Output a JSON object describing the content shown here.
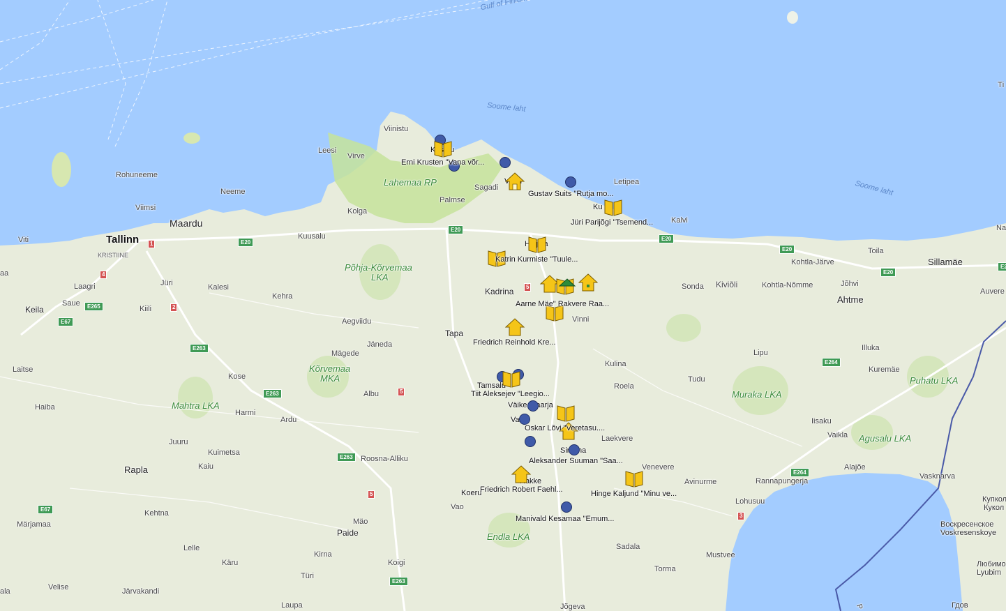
{
  "colors": {
    "sea": "#a3ccff",
    "land": "#e8ecdc",
    "park": "#c5e39b",
    "forest": "#d3e6b8",
    "marker": "#f5c518",
    "dot": "#3f5aa8",
    "border": "#4a5aa8"
  },
  "sea_labels": {
    "gulf": "Gulf of Finland",
    "soome1": "Soome laht",
    "soome2": "Soome laht"
  },
  "places": {
    "tallinn": "Tallinn",
    "kristiine": "KRISTIINE",
    "maardu": "Maardu",
    "viimsi": "Viimsi",
    "rohuneeme": "Rohuneeme",
    "viti": "Viti",
    "neeme": "Neeme",
    "kuusalu": "Kuusalu",
    "kolga": "Kolga",
    "palmse": "Palmse",
    "sagadi": "Sagadi",
    "viinistu": "Viinistu",
    "leesi": "Leesi",
    "virve": "Virve",
    "letipea": "Letipea",
    "kalvi": "Kalvi",
    "toila": "Toila",
    "sillamae": "Sillamäe",
    "kohtla_jarve": "Kohtla-Järve",
    "kohtla_nomme": "Kohtla-Nõmme",
    "johvi": "Jõhvi",
    "ahtme": "Ahtme",
    "kivioli": "Kiviõli",
    "sonda": "Sonda",
    "auvere": "Auvere",
    "laagri": "Laagri",
    "juri": "Jüri",
    "saue": "Saue",
    "keila": "Keila",
    "kiili": "Kiili",
    "kalesi": "Kalesi",
    "kehra": "Kehra",
    "aegviidu": "Aegviidu",
    "janeda": "Jäneda",
    "tapa": "Tapa",
    "kadrina": "Kadrina",
    "vinni": "Vinni",
    "kulina": "Kulina",
    "roela": "Roela",
    "tudu": "Tudu",
    "lipu": "Lipu",
    "illuka": "Illuka",
    "kuremae": "Kuremäe",
    "iisaku": "Iisaku",
    "vaikla": "Vaikla",
    "alajoe": "Alajõe",
    "vasknarva": "Vasknarva",
    "rannapungerja": "Rannapungerja",
    "avinurme": "Avinurme",
    "venevere": "Venevere",
    "laekvere": "Laekvere",
    "lohusuu": "Lohusuu",
    "mustvee": "Mustvee",
    "sadala": "Sadala",
    "torma": "Torma",
    "jogeva": "Jõgeva",
    "magede": "Mägede",
    "albu": "Albu",
    "kose": "Kose",
    "harmi": "Harmi",
    "ardu": "Ardu",
    "laitse": "Laitse",
    "haiba": "Haiba",
    "juuru": "Juuru",
    "kuimetsa": "Kuimetsa",
    "kaiu": "Kaiu",
    "rapla": "Rapla",
    "roosna": "Roosna-Alliku",
    "kehtna": "Kehtna",
    "marjamaa": "Märjamaa",
    "lelle": "Lelle",
    "karu": "Käru",
    "velise": "Velise",
    "jarvakandi": "Järvakandi",
    "turi": "Türi",
    "kirna": "Kirna",
    "paide": "Paide",
    "mao": "Mäo",
    "koigi": "Koigi",
    "laupa": "Laupa",
    "vao": "Vao",
    "ala": "ala",
    "aa": "aa",
    "kupkol": "Купкол",
    "kukol": "Кукол",
    "vosk1": "Воскресенское",
    "vosk2": "Voskresenskoye",
    "lyub1": "Любимо",
    "lyub2": "Lyubim",
    "gdov": "Гдов",
    "na": "Na",
    "ti": "Ті",
    "ru_p": "P"
  },
  "parks": {
    "lahemaa": "Lahemaa RP",
    "pohja1": "Põhja-Kõrvemaa",
    "pohja2": "LKA",
    "korv1": "Kõrvemaa",
    "korv2": "MKA",
    "mahtra": "Mahtra LKA",
    "muraka": "Muraka LKA",
    "puhatu": "Puhatu LKA",
    "agusalu": "Agusalu LKA",
    "endla": "Endla LKA"
  },
  "roads": {
    "e20": "E20",
    "e265": "E265",
    "e67": "E67",
    "e263": "E263",
    "e264": "E264",
    "r1": "1",
    "r2": "2",
    "r3": "3",
    "r4": "4",
    "r5": "5"
  },
  "marker_labels": {
    "krusten": "Erni Krusten \"Vana võr...",
    "suits": "Gustav Suits \"Rutja mo...",
    "parijogi": "Jüri Parijõgi \"Tsemend...",
    "kurmiste": "Katrin Kurmiste \"Tuule...",
    "mae": "Aarne Mäe\" Rakvere Raa...",
    "kreutzwald": "Friedrich Reinhold Kre...",
    "aleksejev": "Tiit Aleksejev \"Leegio...",
    "lovi": "Oskar Lõvi \"Veretasu....",
    "suuman": "Aleksander Suuman \"Saa...",
    "faehlmann": "Friedrich Robert Faehl...",
    "kaljund": "Hinge Kaljund \"Minu ve...",
    "kesamaa": "Manivald Kesamaa \"Emum..."
  },
  "partial_labels": {
    "kasmu": "Käsmu",
    "vosu": "Võsu",
    "kunda": "Ku",
    "haljala": "Haljala",
    "rakvere": "ere",
    "tamsalu": "Tamsalu",
    "vaike_maarja": "Väike-Maarja",
    "vao2": "Va",
    "simuna": "Simuna",
    "rakke": "Rakke",
    "koeru": "Koeru"
  }
}
